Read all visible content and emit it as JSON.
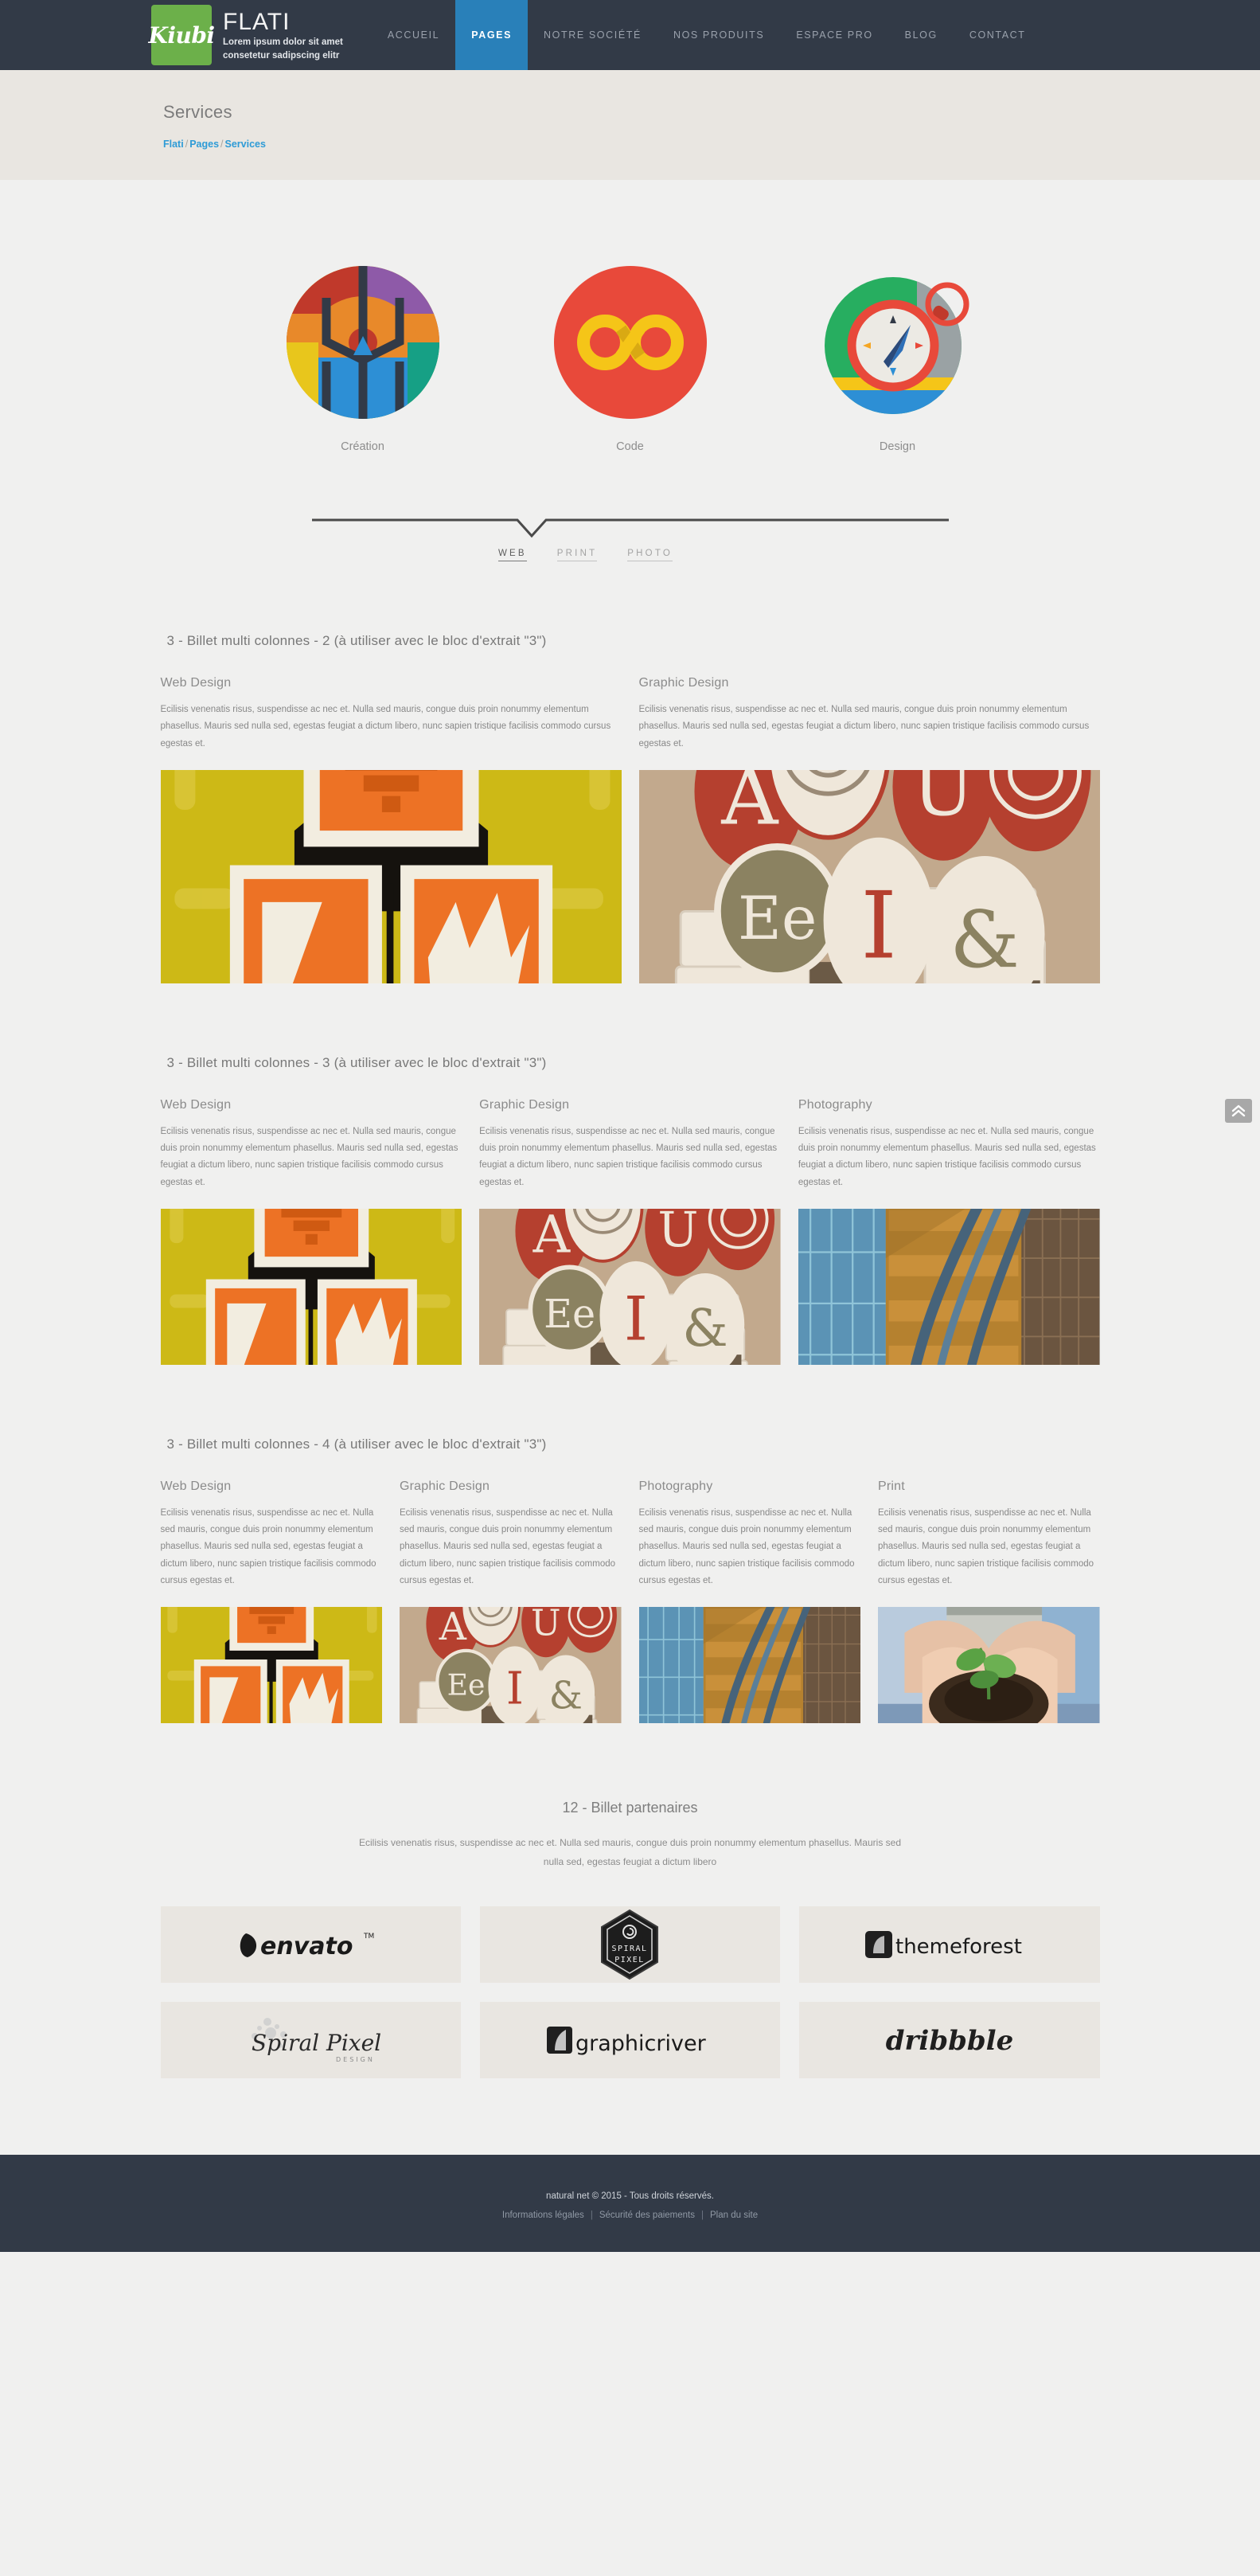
{
  "header": {
    "logo_text": "Kiubi",
    "brand_title": "FLATI",
    "brand_sub_line1": "Lorem ipsum dolor sit amet",
    "brand_sub_line2": "consetetur sadipscing elitr",
    "nav": [
      {
        "label": "ACCUEIL",
        "active": false
      },
      {
        "label": "PAGES",
        "active": true
      },
      {
        "label": "NOTRE SOCIÉTÉ",
        "active": false
      },
      {
        "label": "NOS PRODUITS",
        "active": false
      },
      {
        "label": "ESPACE PRO",
        "active": false
      },
      {
        "label": "BLOG",
        "active": false
      },
      {
        "label": "CONTACT",
        "active": false
      }
    ],
    "accent_color": "#2980b9",
    "bar_color": "#323a47",
    "logo_color": "#6cb04a"
  },
  "titlebar": {
    "title": "Services",
    "breadcrumb": [
      "Flati",
      "Pages",
      "Services"
    ],
    "breadcrumb_separator": "/",
    "link_color": "#2e9bd6"
  },
  "services": [
    {
      "label": "Création",
      "icon": "colored-pencils-icon"
    },
    {
      "label": "Code",
      "icon": "infinity-icon"
    },
    {
      "label": "Design",
      "icon": "compass-icon"
    }
  ],
  "tabs": [
    {
      "label": "WEB",
      "active": true
    },
    {
      "label": "PRINT",
      "active": false
    },
    {
      "label": "PHOTO",
      "active": false
    }
  ],
  "sections": [
    {
      "title": "3 - Billet multi colonnes - 2 (à utiliser avec le bloc d'extrait \"3\")",
      "columns": [
        {
          "heading": "Web Design",
          "body": "Ecilisis venenatis risus, suspendisse ac nec et. Nulla sed mauris, congue duis proin nonummy elementum phasellus. Mauris sed nulla sed, egestas feugiat a dictum libero, nunc sapien tristique facilisis commodo cursus egestas et.",
          "image": "retro-robot-illustration"
        },
        {
          "heading": "Graphic Design",
          "body": "Ecilisis venenatis risus, suspendisse ac nec et. Nulla sed mauris, congue duis proin nonummy elementum phasellus. Mauris sed nulla sed, egestas feugiat a dictum libero, nunc sapien tristique facilisis commodo cursus egestas et.",
          "image": "letterpress-type-coasters"
        }
      ]
    },
    {
      "title": "3 - Billet multi colonnes - 3 (à utiliser avec le bloc d'extrait \"3\")",
      "columns": [
        {
          "heading": "Web Design",
          "body": "Ecilisis venenatis risus, suspendisse ac nec et. Nulla sed mauris, congue duis proin nonummy elementum phasellus. Mauris sed nulla sed, egestas feugiat a dictum libero, nunc sapien tristique facilisis commodo cursus egestas et.",
          "image": "retro-robot-illustration"
        },
        {
          "heading": "Graphic Design",
          "body": "Ecilisis venenatis risus, suspendisse ac nec et. Nulla sed mauris, congue duis proin nonummy elementum phasellus. Mauris sed nulla sed, egestas feugiat a dictum libero, nunc sapien tristique facilisis commodo cursus egestas et.",
          "image": "letterpress-type-coasters"
        },
        {
          "heading": "Photography",
          "body": "Ecilisis venenatis risus, suspendisse ac nec et. Nulla sed mauris, congue duis proin nonummy elementum phasellus. Mauris sed nulla sed, egestas feugiat a dictum libero, nunc sapien tristique facilisis commodo cursus egestas et.",
          "image": "spiral-staircase-photo"
        }
      ]
    },
    {
      "title": "3 - Billet multi colonnes - 4 (à utiliser avec le bloc d'extrait \"3\")",
      "columns": [
        {
          "heading": "Web Design",
          "body": "Ecilisis venenatis risus, suspendisse ac nec et. Nulla sed mauris, congue duis proin nonummy elementum phasellus. Mauris sed nulla sed, egestas feugiat a dictum libero, nunc sapien tristique facilisis commodo cursus egestas et.",
          "image": "retro-robot-illustration"
        },
        {
          "heading": "Graphic Design",
          "body": "Ecilisis venenatis risus, suspendisse ac nec et. Nulla sed mauris, congue duis proin nonummy elementum phasellus. Mauris sed nulla sed, egestas feugiat a dictum libero, nunc sapien tristique facilisis commodo cursus egestas et.",
          "image": "letterpress-type-coasters"
        },
        {
          "heading": "Photography",
          "body": "Ecilisis venenatis risus, suspendisse ac nec et. Nulla sed mauris, congue duis proin nonummy elementum phasellus. Mauris sed nulla sed, egestas feugiat a dictum libero, nunc sapien tristique facilisis commodo cursus egestas et.",
          "image": "spiral-staircase-photo"
        },
        {
          "heading": "Print",
          "body": "Ecilisis venenatis risus, suspendisse ac nec et. Nulla sed mauris, congue duis proin nonummy elementum phasellus. Mauris sed nulla sed, egestas feugiat a dictum libero, nunc sapien tristique facilisis commodo cursus egestas et.",
          "image": "hands-holding-seedling-photo"
        }
      ]
    }
  ],
  "partners": {
    "title": "12 - Billet partenaires",
    "lead": "Ecilisis venenatis risus, suspendisse ac nec et. Nulla sed mauris, congue duis proin nonummy elementum phasellus. Mauris sed nulla sed, egestas feugiat a dictum libero",
    "logos": [
      {
        "name": "envato",
        "label": "envato"
      },
      {
        "name": "spiral-pixel-badge",
        "label": "SPIRAL PIXEL"
      },
      {
        "name": "themeforest",
        "label": "themeforest"
      },
      {
        "name": "spiral-pixel-script",
        "label": "Spiral Pixel"
      },
      {
        "name": "graphicriver",
        "label": "graphicriver"
      },
      {
        "name": "dribbble",
        "label": "dribbble"
      }
    ]
  },
  "scroll_top": {
    "icon": "double-chevron-up-icon"
  },
  "footer": {
    "copyright": "natural net © 2015 - Tous droits réservés.",
    "links": [
      "Informations légales",
      "Sécurité des paiements",
      "Plan du site"
    ],
    "separator": "|"
  }
}
